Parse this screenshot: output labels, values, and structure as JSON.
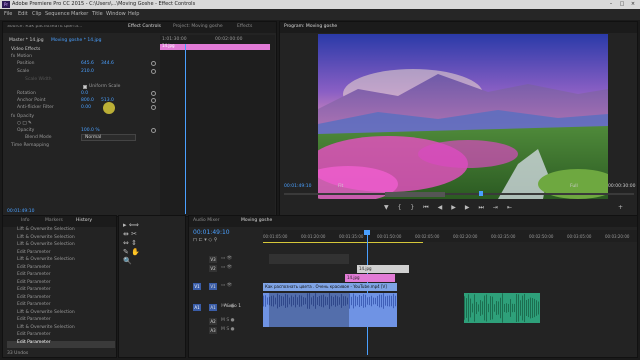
{
  "window": {
    "title": "Adobe Premiere Pro CC 2015 - C:\\Users\\...\\Moving Goshe - Effect Controls",
    "logo": "Pr"
  },
  "menu": [
    "File",
    "Edit",
    "Clip",
    "Sequence",
    "Marker",
    "Title",
    "Window",
    "Help"
  ],
  "effect_controls": {
    "tabs": [
      "Source: Как распознать цвета...",
      "Effect Controls",
      "Project: Moving goshe",
      "Effects"
    ],
    "master": "Master * 14.jpg",
    "sequence": "Moving goshe * 14.jpg",
    "ruler_start": "1:01:30:00",
    "ruler_end": "00:02:00:00",
    "clip_label": "14.jpg",
    "section_video": "Video Effects",
    "motion": "Motion",
    "position_label": "Position",
    "position_x": "645.6",
    "position_y": "344.6",
    "scale_label": "Scale",
    "scale_value": "210.0",
    "scale_width_label": "Scale Width",
    "uniform_label": "Uniform Scale",
    "rotation_label": "Rotation",
    "rotation_value": "0.0",
    "anchor_label": "Anchor Point",
    "anchor_x": "800.0",
    "anchor_y": "513.0",
    "flicker_label": "Anti-flicker Filter",
    "flicker_value": "0.00",
    "opacity_section": "Opacity",
    "opacity_label": "Opacity",
    "opacity_value": "100.0 %",
    "blend_label": "Blend Mode",
    "blend_value": "Normal",
    "time_remap": "Time Remapping",
    "timecode": "00:01:49:10"
  },
  "program": {
    "tab": "Program: Moving goshe",
    "timecode": "00:01:49:10",
    "fit": "Fit",
    "quality": "Full",
    "duration": "00:00:30:00"
  },
  "history": {
    "tabs": [
      "Info",
      "Markers",
      "History"
    ],
    "items": [
      "Lift & Overwrite Selection",
      "Lift & Overwrite Selection",
      "Lift & Overwrite Selection",
      "Edit Parameter",
      "Lift & Overwrite Selection",
      "Edit Parameter",
      "Edit Parameter",
      "Edit Parameter",
      "Edit Parameter",
      "Edit Parameter",
      "Edit Parameter",
      "Lift & Overwrite Selection",
      "Edit Parameter",
      "Lift & Overwrite Selection",
      "Edit Parameter",
      "Edit Parameter"
    ],
    "undos": "33 Undos"
  },
  "timeline": {
    "tabs": [
      "Audio Mixer",
      "Moving goshe"
    ],
    "timecode": "00:01:49:10",
    "ruler": [
      "00:01:05:00",
      "00:01:20:00",
      "00:01:35:00",
      "00:01:50:00",
      "00:02:05:00",
      "00:02:20:00",
      "00:02:35:00",
      "00:02:50:00",
      "00:03:05:00",
      "00:03:20:00"
    ],
    "video_tracks": [
      "V3",
      "V2",
      "V1"
    ],
    "audio_tracks": [
      "A1",
      "A2",
      "A3"
    ],
    "source_v": "V1",
    "source_a": "A1",
    "audio1_label": "Audio 1",
    "clip_v3": "14.jpg",
    "clip_v2": "14.jpg",
    "clip_v1": "Как распознать цвета . Очень красивое - YouTube.mp4 [V]"
  },
  "colors": {
    "accent": "#4aa0ff",
    "clip_pink": "#e27bd6",
    "clip_video": "#7fa4e6",
    "clip_audio": "#2ea07a",
    "audio_blue": "#6f93e4"
  }
}
